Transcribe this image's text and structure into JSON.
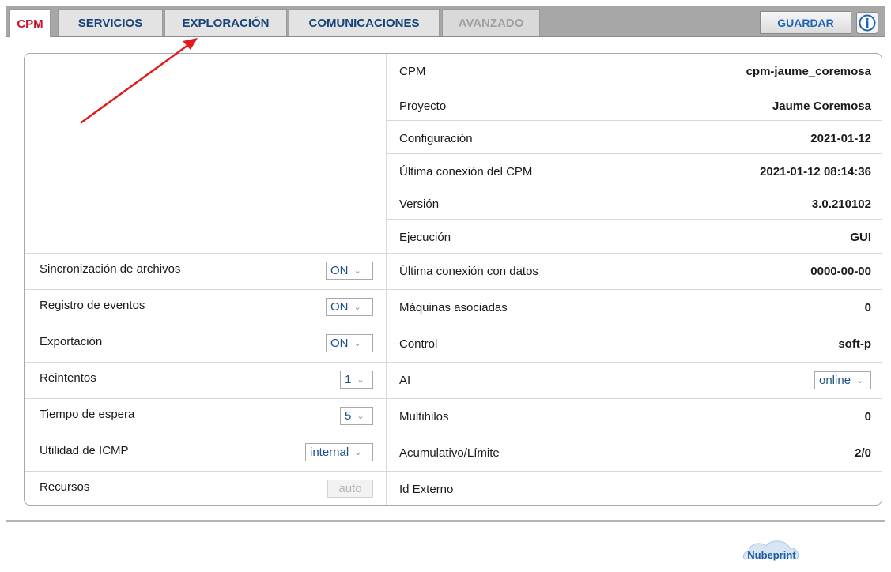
{
  "tabs": [
    {
      "label": "CPM",
      "state": "active"
    },
    {
      "label": "SERVICIOS",
      "state": "normal"
    },
    {
      "label": "EXPLORACIÓN",
      "state": "normal"
    },
    {
      "label": "COMUNICACIONES",
      "state": "normal"
    },
    {
      "label": "AVANZADO",
      "state": "disabled"
    }
  ],
  "toolbar": {
    "save_label": "GUARDAR",
    "info_icon": "info-icon"
  },
  "settings": [
    {
      "label": "Sincronización de archivos",
      "value": "ON"
    },
    {
      "label": "Registro de eventos",
      "value": "ON"
    },
    {
      "label": "Exportación",
      "value": "ON"
    },
    {
      "label": "Reintentos",
      "value": "1"
    },
    {
      "label": "Tiempo de espera",
      "value": "5"
    },
    {
      "label": "Utilidad de ICMP",
      "value": "internal"
    },
    {
      "label": "Recursos",
      "value": "auto",
      "disabled": true
    }
  ],
  "info": [
    {
      "label": "CPM",
      "value": "cpm-jaume_coremosa"
    },
    {
      "label": "Proyecto",
      "value": "Jaume Coremosa"
    },
    {
      "label": "Configuración",
      "value": "2021-01-12"
    },
    {
      "label": "Última conexión del CPM",
      "value": "2021-01-12 08:14:36"
    },
    {
      "label": "Versión",
      "value": "3.0.210102"
    },
    {
      "label": "Ejecución",
      "value": "GUI"
    },
    {
      "label": "Última conexión con datos",
      "value": "0000-00-00"
    },
    {
      "label": "Máquinas asociadas",
      "value": "0"
    },
    {
      "label": "Control",
      "value": "soft-p"
    },
    {
      "label": "AI",
      "value": "online",
      "type": "select"
    },
    {
      "label": "Multihilos",
      "value": "0"
    },
    {
      "label": "Acumulativo/Límite",
      "value": "2/0"
    },
    {
      "label": "Id Externo",
      "value": ""
    }
  ],
  "footer": {
    "logo_text": "Nubeprint"
  },
  "colors": {
    "active_tab": "#c8102e",
    "tab_text": "#17437a",
    "save_text": "#1d63b6",
    "annotation_arrow": "#e11b1b"
  }
}
